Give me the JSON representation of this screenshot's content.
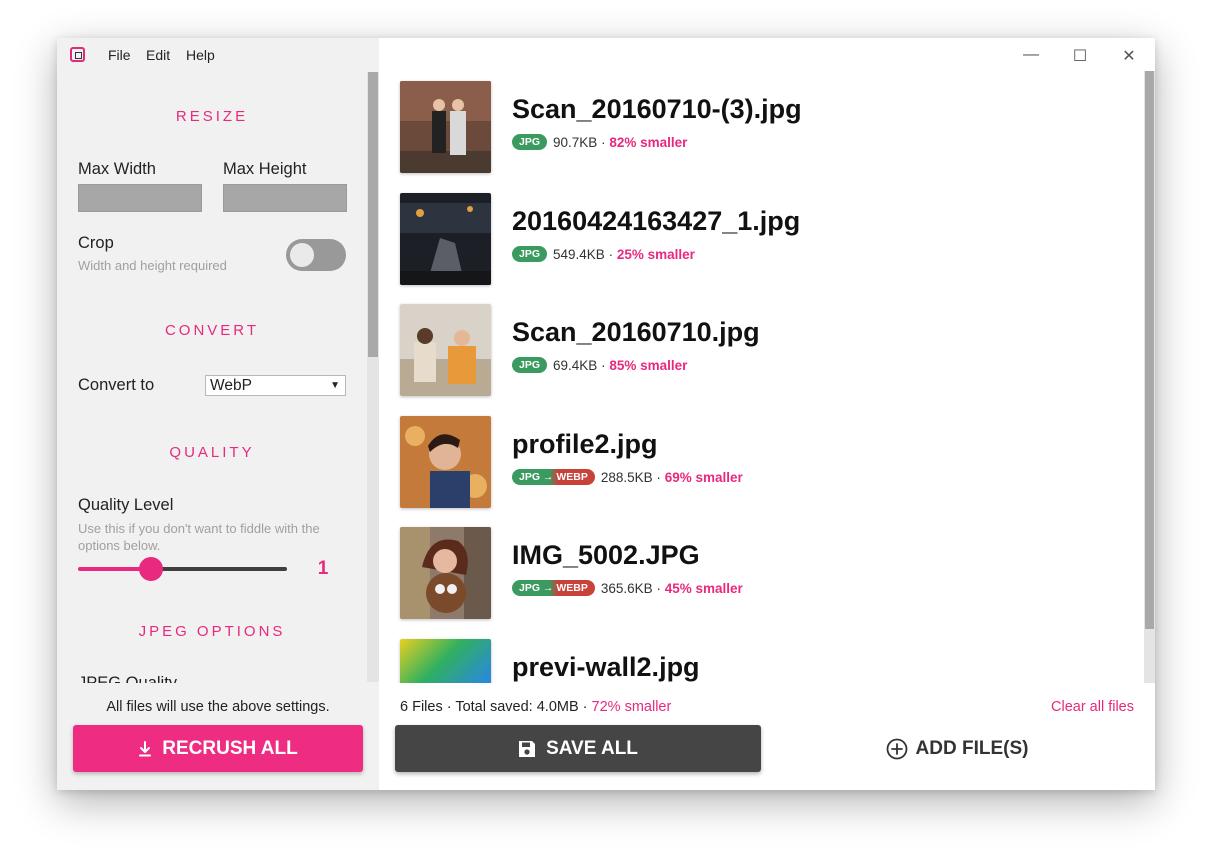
{
  "menu": {
    "file": "File",
    "edit": "Edit",
    "help": "Help"
  },
  "window_controls": {
    "minimize": "—",
    "maximize": "☐",
    "close": "✕"
  },
  "sidebar": {
    "resize": {
      "title": "RESIZE",
      "max_width_label": "Max Width",
      "max_width_value": "",
      "max_height_label": "Max Height",
      "max_height_value": "",
      "crop_label": "Crop",
      "crop_hint": "Width and height required",
      "crop_enabled": false
    },
    "convert": {
      "title": "CONVERT",
      "convert_label": "Convert to",
      "selected": "WebP"
    },
    "quality": {
      "title": "QUALITY",
      "label": "Quality Level",
      "hint": "Use this if you don't want to fiddle with the options below.",
      "value": "1"
    },
    "jpeg": {
      "title": "JPEG OPTIONS",
      "partial_label": "JPEG Quality"
    },
    "footer_note": "All files will use the above settings.",
    "recrush_label": "RECRUSH ALL"
  },
  "files": [
    {
      "name": "Scan_20160710-(3).jpg",
      "badge": "JPG",
      "size": "90.7KB",
      "separator": "·",
      "savings": "82% smaller"
    },
    {
      "name": "20160424163427_1.jpg",
      "badge": "JPG",
      "size": "549.4KB",
      "separator": "·",
      "savings": "25% smaller"
    },
    {
      "name": "Scan_20160710.jpg",
      "badge": "JPG",
      "size": "69.4KB",
      "separator": "·",
      "savings": "85% smaller"
    },
    {
      "name": "profile2.jpg",
      "badge": "JPG → WEBP",
      "size": "288.5KB",
      "separator": "·",
      "savings": "69% smaller"
    },
    {
      "name": "IMG_5002.JPG",
      "badge": "JPG → WEBP",
      "size": "365.6KB",
      "separator": "·",
      "savings": "45% smaller"
    },
    {
      "name": "previ-wall2.jpg"
    }
  ],
  "footer": {
    "summary_prefix": "6 Files · Total saved: 4.0MB ·",
    "summary_pct": "72% smaller",
    "clear_label": "Clear all files",
    "save_label": "SAVE ALL",
    "add_label": "ADD FILE(S)"
  },
  "colors": {
    "accent": "#e8297f",
    "badge_green": "#3b9a5f",
    "badge_red": "#c9423a",
    "save_button": "#454545"
  }
}
